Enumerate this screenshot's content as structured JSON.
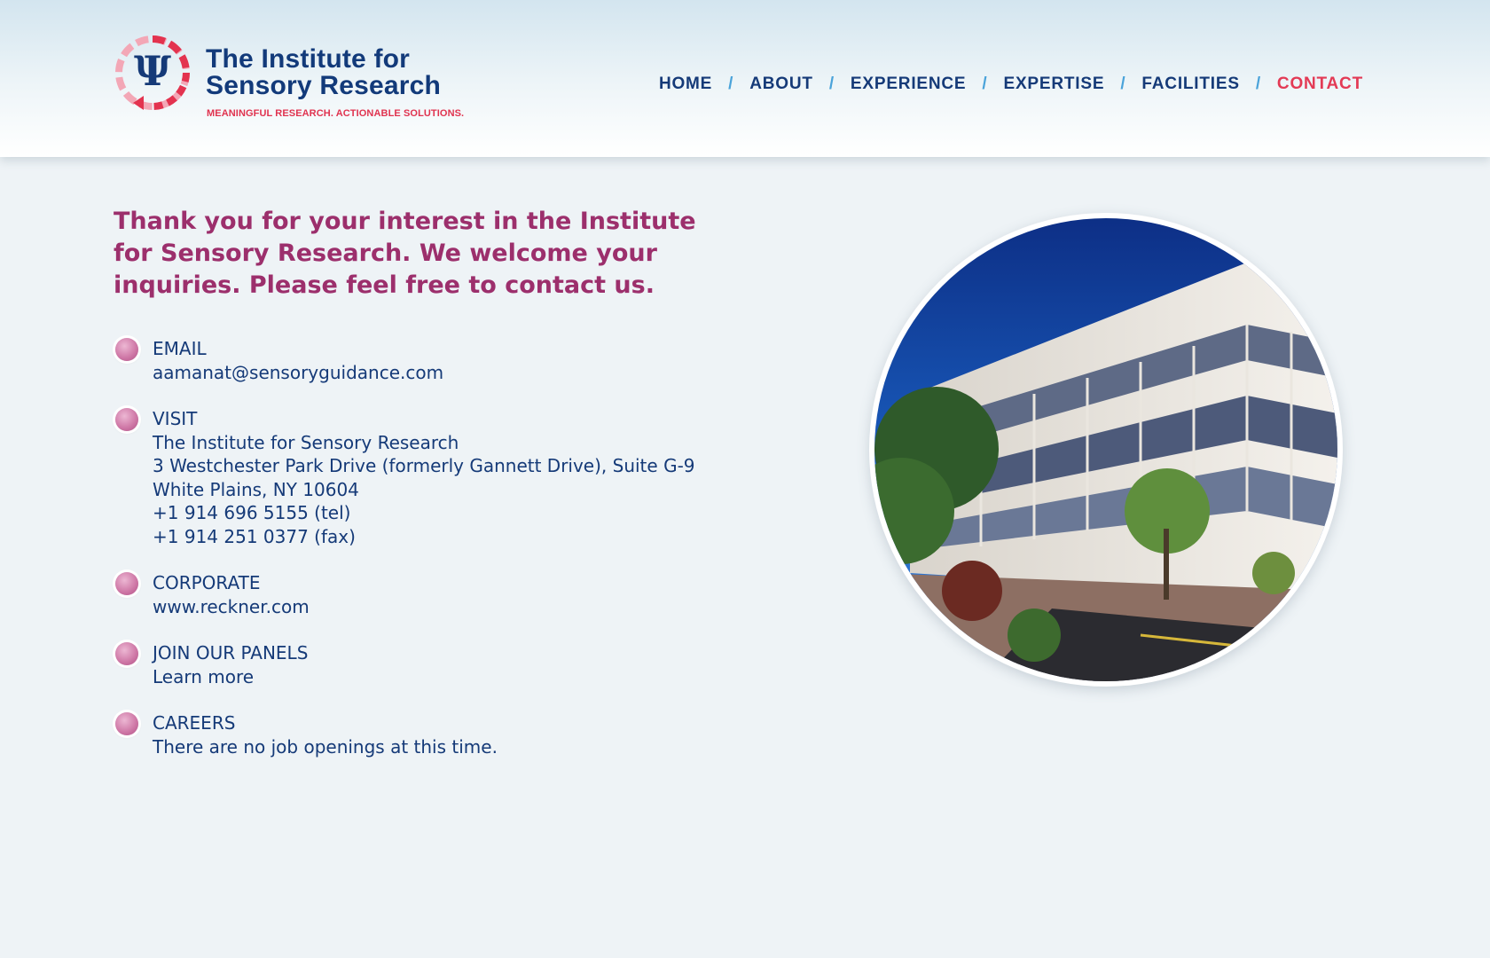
{
  "brand": {
    "title_line1": "The Institute for",
    "title_line2": "Sensory Research",
    "tagline": "MEANINGFUL RESEARCH. ACTIONABLE SOLUTIONS.",
    "logo_icon": "psi-circle-logo",
    "colors": {
      "navy": "#153a78",
      "red": "#e33a55",
      "magenta": "#9c2f6c",
      "separator_blue": "#4aa3da"
    }
  },
  "nav": {
    "items": [
      {
        "label": "HOME"
      },
      {
        "label": "ABOUT"
      },
      {
        "label": "EXPERIENCE"
      },
      {
        "label": "EXPERTISE"
      },
      {
        "label": "FACILITIES"
      },
      {
        "label": "CONTACT",
        "active": true
      }
    ],
    "separator": "/"
  },
  "intro": "Thank you for your interest in the Institute for Sensory Research. We welcome your inquiries. Please feel free to contact us.",
  "contact": [
    {
      "title": "EMAIL",
      "lines": [
        "aamanat@sensoryguidance.com"
      ]
    },
    {
      "title": "VISIT",
      "lines": [
        "The Institute for Sensory Research",
        "3 Westchester Park Drive (formerly Gannett Drive), Suite G-9",
        "White Plains, NY 10604",
        "+1 914 696 5155 (tel)",
        "+1 914 251 0377 (fax)"
      ]
    },
    {
      "title": "CORPORATE",
      "lines": [
        "www.reckner.com"
      ]
    },
    {
      "title": "JOIN OUR PANELS",
      "lines": [
        "Learn more"
      ]
    },
    {
      "title": "CAREERS",
      "lines": [
        "There are no job openings at this time."
      ]
    }
  ],
  "photo": {
    "icon": "office-building-photo"
  }
}
